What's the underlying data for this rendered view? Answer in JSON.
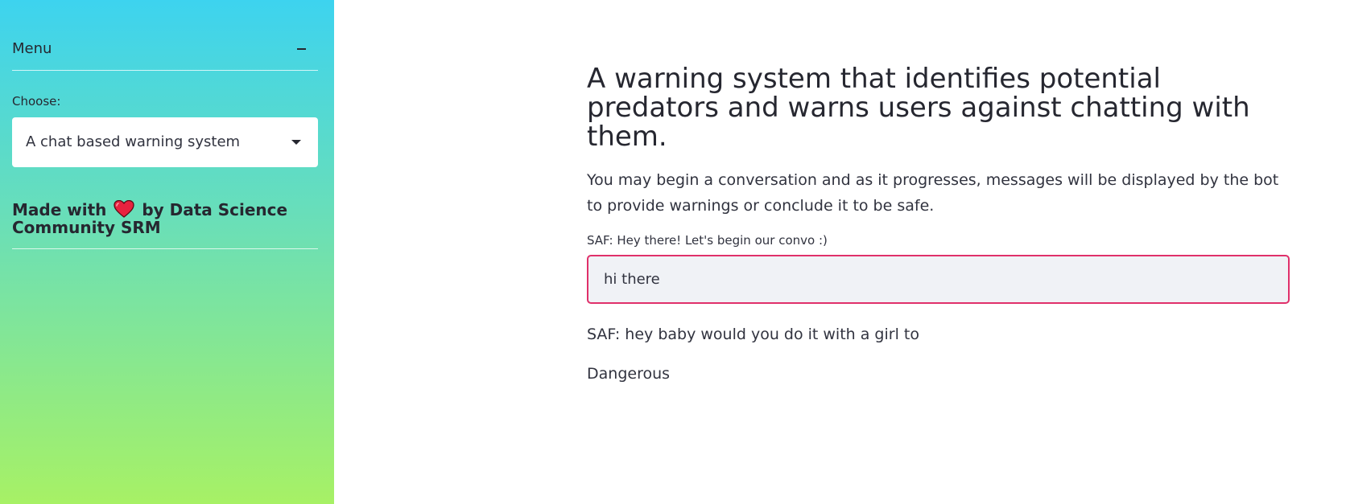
{
  "sidebar": {
    "menu_title": "Menu",
    "collapse_symbol": "−",
    "choose_label": "Choose:",
    "select": {
      "value": "A chat based warning system"
    },
    "credit": {
      "prefix": "Made with",
      "suffix": "by Data Science Community SRM",
      "icon": "heart-icon"
    },
    "colors": {
      "gradient_top": "#3dd3ef",
      "gradient_mid": "#6bdfb6",
      "gradient_bottom": "#a7f165"
    }
  },
  "main": {
    "title": "A warning system that identifies potential predators and warns users against chatting with them.",
    "description": "You may begin a conversation and as it progresses, messages will be displayed by the bot to provide warnings or conclude it to be safe.",
    "input_label": "SAF: Hey there! Let's begin our convo :)",
    "input_value": "hi there",
    "bot_message": "SAF: hey baby would you do it with a girl to",
    "verdict": "Dangerous",
    "colors": {
      "input_border": "#e0306a",
      "input_background": "#f0f2f6"
    }
  }
}
